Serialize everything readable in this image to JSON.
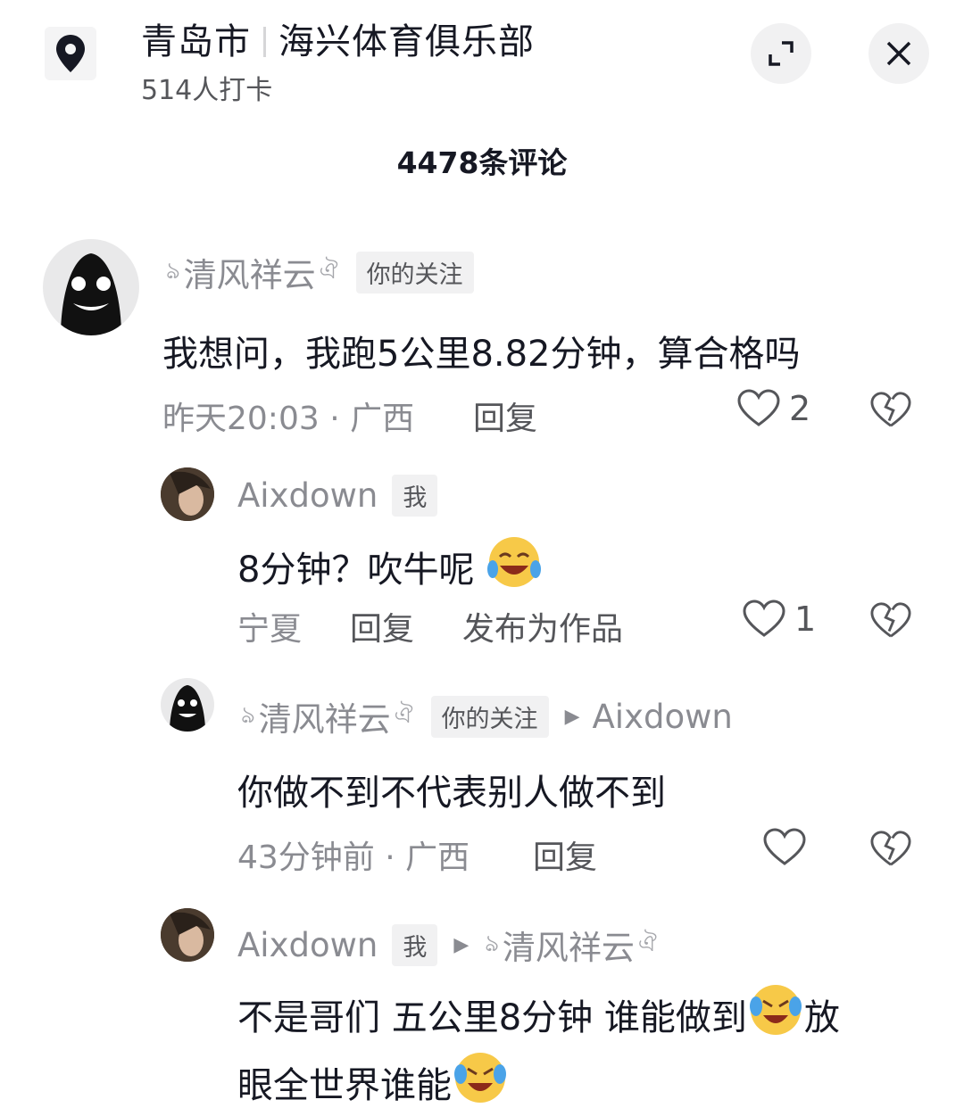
{
  "header": {
    "city": "青岛市",
    "place": "海兴体育俱乐部",
    "checkins": "514人打卡",
    "location_icon": "location-pin-icon",
    "expand_icon": "collapse-icon",
    "close_icon": "close-icon"
  },
  "comment_count": "4478条评论",
  "comments": [
    {
      "user": "清风祥云",
      "tag": "你的关注",
      "text": "我想问，我跑5公里8.82分钟，算合格吗",
      "meta": "昨天20:03 · 广西",
      "reply": "回复",
      "likes": "2"
    },
    {
      "user": "Aixdown",
      "tag": "我",
      "text": "8分钟？吹牛呢",
      "meta": "宁夏",
      "reply": "回复",
      "publish": "发布为作品",
      "likes": "1"
    },
    {
      "user": "清风祥云",
      "tag": "你的关注",
      "reply_to": "Aixdown",
      "text": "你做不到不代表别人做不到",
      "meta": "43分钟前 · 广西",
      "reply": "回复",
      "likes": ""
    },
    {
      "user": "Aixdown",
      "tag": "我",
      "reply_to": "清风祥云",
      "text_line1": "不是哥们 五公里8分钟 谁能做到",
      "text_line1_end": "放",
      "text_line2": "眼全世界谁能"
    }
  ],
  "colors": {
    "text": "#161823",
    "meta": "#8a8b91",
    "tag_bg": "#f1f1f2"
  }
}
